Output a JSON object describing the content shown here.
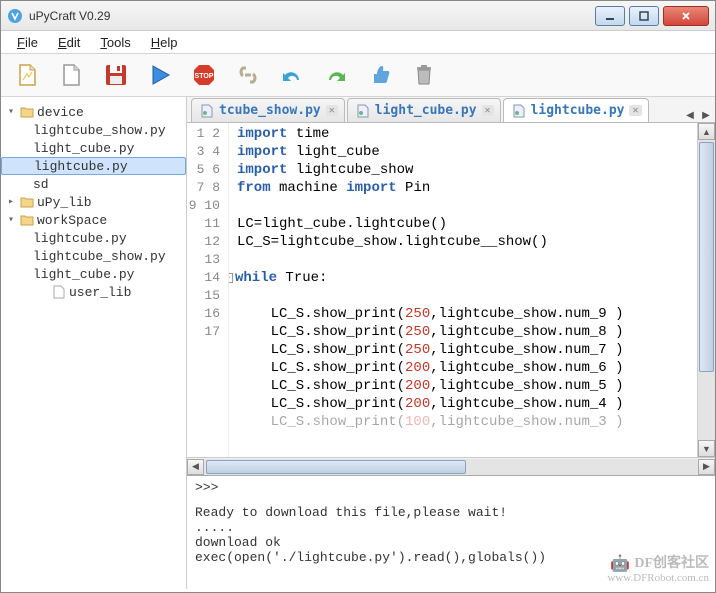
{
  "window": {
    "title": "uPyCraft V0.29"
  },
  "menu": {
    "file": "File",
    "edit": "Edit",
    "tools": "Tools",
    "help": "Help"
  },
  "toolbar_icons": [
    "new",
    "open",
    "save",
    "run",
    "stop",
    "link",
    "undo",
    "redo",
    "like",
    "trash"
  ],
  "tree": {
    "root": "device",
    "device_files": [
      "lightcube_show.py",
      "light_cube.py",
      "lightcube.py",
      "sd"
    ],
    "upylib": "uPy_lib",
    "workspace": "workSpace",
    "workspace_files": [
      "lightcube.py",
      "lightcube_show.py",
      "light_cube.py",
      "user_lib"
    ],
    "selected": "lightcube.py"
  },
  "tabs": [
    {
      "label": "tcube_show.py",
      "active": false,
      "partial": true
    },
    {
      "label": "light_cube.py",
      "active": false
    },
    {
      "label": "lightcube.py",
      "active": true
    }
  ],
  "code": {
    "lines": [
      {
        "n": 1,
        "html": "<span class='kw'>import</span> time"
      },
      {
        "n": 2,
        "html": "<span class='kw'>import</span> light_cube"
      },
      {
        "n": 3,
        "html": "<span class='kw'>import</span> lightcube_show"
      },
      {
        "n": 4,
        "html": "<span class='kw'>from</span> machine <span class='kw'>import</span> Pin"
      },
      {
        "n": 5,
        "html": ""
      },
      {
        "n": 6,
        "html": "LC=light_cube.lightcube()"
      },
      {
        "n": 7,
        "html": "LC_S=lightcube_show.lightcube__show()"
      },
      {
        "n": 8,
        "html": ""
      },
      {
        "n": 9,
        "html": "<span class='kw'>while</span> True:",
        "fold": true
      },
      {
        "n": 10,
        "html": ""
      },
      {
        "n": 11,
        "html": "    LC_S.show_print(<span class='num'>250</span>,lightcube_show.num_9 )"
      },
      {
        "n": 12,
        "html": "    LC_S.show_print(<span class='num'>250</span>,lightcube_show.num_8 )"
      },
      {
        "n": 13,
        "html": "    LC_S.show_print(<span class='num'>250</span>,lightcube_show.num_7 )"
      },
      {
        "n": 14,
        "html": "    LC_S.show_print(<span class='num'>200</span>,lightcube_show.num_6 )"
      },
      {
        "n": 15,
        "html": "    LC_S.show_print(<span class='num'>200</span>,lightcube_show.num_5 )"
      },
      {
        "n": 16,
        "html": "    LC_S.show_print(<span class='num'>200</span>,lightcube_show.num_4 )"
      },
      {
        "n": 17,
        "html": "    LC_S.show_print(<span class='num'>100</span>,lightcube_show.num_3 )",
        "cut": true
      }
    ]
  },
  "console": {
    "prompt": ">>>",
    "lines": [
      "Ready to download this file,please wait!",
      ".....",
      "download ok",
      "exec(open('./lightcube.py').read(),globals())"
    ]
  },
  "watermark": {
    "big": "DF创客社区",
    "small": "www.DFRobot.com.cn"
  }
}
